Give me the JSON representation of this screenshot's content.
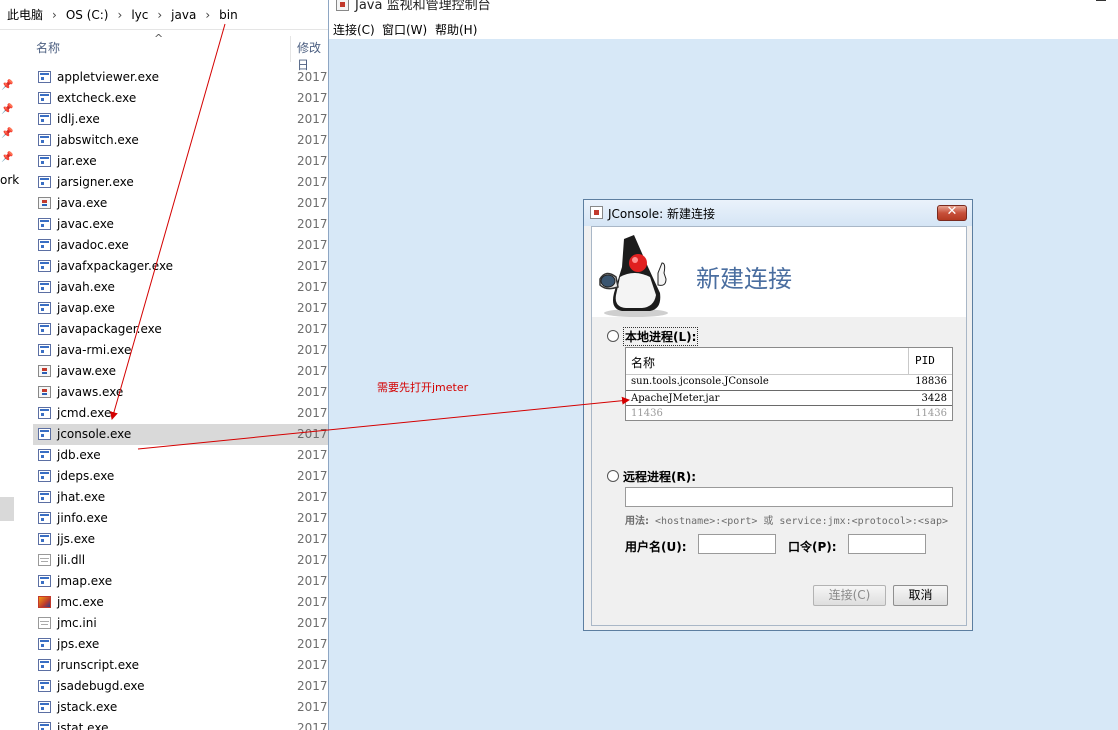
{
  "explorer": {
    "breadcrumb": [
      "此电脑",
      "OS (C:)",
      "lyc",
      "java",
      "bin"
    ],
    "columns": {
      "name": "名称",
      "date": "修改日"
    },
    "nav_label": "ork",
    "files": [
      {
        "name": "appletviewer.exe",
        "date": "2017",
        "icon": "exe-icon"
      },
      {
        "name": "extcheck.exe",
        "date": "2017",
        "icon": "exe-icon"
      },
      {
        "name": "idlj.exe",
        "date": "2017",
        "icon": "exe-icon"
      },
      {
        "name": "jabswitch.exe",
        "date": "2017",
        "icon": "exe-icon"
      },
      {
        "name": "jar.exe",
        "date": "2017",
        "icon": "exe-icon"
      },
      {
        "name": "jarsigner.exe",
        "date": "2017",
        "icon": "exe-icon"
      },
      {
        "name": "java.exe",
        "date": "2017",
        "icon": "java-icon"
      },
      {
        "name": "javac.exe",
        "date": "2017",
        "icon": "exe-icon"
      },
      {
        "name": "javadoc.exe",
        "date": "2017",
        "icon": "exe-icon"
      },
      {
        "name": "javafxpackager.exe",
        "date": "2017",
        "icon": "exe-icon"
      },
      {
        "name": "javah.exe",
        "date": "2017",
        "icon": "exe-icon"
      },
      {
        "name": "javap.exe",
        "date": "2017",
        "icon": "exe-icon"
      },
      {
        "name": "javapackager.exe",
        "date": "2017",
        "icon": "exe-icon"
      },
      {
        "name": "java-rmi.exe",
        "date": "2017",
        "icon": "exe-icon"
      },
      {
        "name": "javaw.exe",
        "date": "2017",
        "icon": "java-icon"
      },
      {
        "name": "javaws.exe",
        "date": "2017",
        "icon": "java-icon"
      },
      {
        "name": "jcmd.exe",
        "date": "2017",
        "icon": "exe-icon"
      },
      {
        "name": "jconsole.exe",
        "date": "2017",
        "icon": "exe-icon",
        "selected": true
      },
      {
        "name": "jdb.exe",
        "date": "2017",
        "icon": "exe-icon"
      },
      {
        "name": "jdeps.exe",
        "date": "2017",
        "icon": "exe-icon"
      },
      {
        "name": "jhat.exe",
        "date": "2017",
        "icon": "exe-icon"
      },
      {
        "name": "jinfo.exe",
        "date": "2017",
        "icon": "exe-icon"
      },
      {
        "name": "jjs.exe",
        "date": "2017",
        "icon": "exe-icon"
      },
      {
        "name": "jli.dll",
        "date": "2017",
        "icon": "dll-icon"
      },
      {
        "name": "jmap.exe",
        "date": "2017",
        "icon": "exe-icon"
      },
      {
        "name": "jmc.exe",
        "date": "2017",
        "icon": "jmc-icon"
      },
      {
        "name": "jmc.ini",
        "date": "2017",
        "icon": "ini-icon"
      },
      {
        "name": "jps.exe",
        "date": "2017",
        "icon": "exe-icon"
      },
      {
        "name": "jrunscript.exe",
        "date": "2017",
        "icon": "exe-icon"
      },
      {
        "name": "jsadebugd.exe",
        "date": "2017",
        "icon": "exe-icon"
      },
      {
        "name": "jstack.exe",
        "date": "2017",
        "icon": "exe-icon"
      },
      {
        "name": "jstat.exe",
        "date": "2017",
        "icon": "exe-icon"
      }
    ]
  },
  "jconsole": {
    "title": "Java 监视和管理控制台",
    "menu": [
      "连接(C)",
      "窗口(W)",
      "帮助(H)"
    ]
  },
  "dialog": {
    "title": "JConsole: 新建连接",
    "heading": "新建连接",
    "local_label": "本地进程(L):",
    "table_headers": {
      "name": "名称",
      "pid": "PID"
    },
    "processes": [
      {
        "name": "sun.tools.jconsole.JConsole",
        "pid": "18836"
      },
      {
        "name": "ApacheJMeter.jar",
        "pid": "3428",
        "selected": true
      },
      {
        "name": "11436",
        "pid": "11436",
        "dim": true
      }
    ],
    "remote_label": "远程进程(R):",
    "remote_value": "",
    "usage_label": "用法:",
    "usage_text": "<hostname>:<port> 或 service:jmx:<protocol>:<sap>",
    "username_label": "用户名(U):",
    "password_label": "口令(P):",
    "connect_button": "连接(C)",
    "cancel_button": "取消"
  },
  "annotation": {
    "text": "需要先打开jmeter",
    "color": "#d40000"
  }
}
